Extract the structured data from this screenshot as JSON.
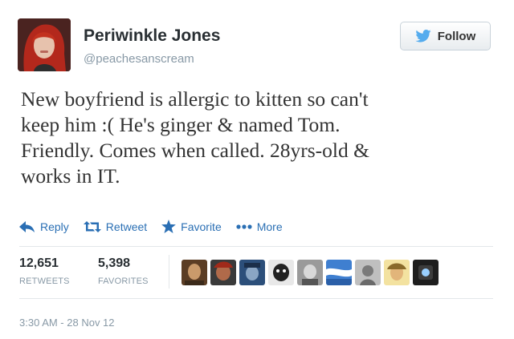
{
  "profile": {
    "name": "Periwinkle Jones",
    "handle": "@peachesanscream"
  },
  "follow_label": "Follow",
  "tweet": {
    "lines": [
      "New boyfriend is allergic to kitten so can't",
      "keep him :( He's ginger & named Tom.",
      "Friendly. Comes when called. 28yrs-old &",
      "works in IT."
    ]
  },
  "actions": {
    "reply": "Reply",
    "retweet": "Retweet",
    "favorite": "Favorite",
    "more": "More"
  },
  "stats": {
    "retweets_count": "12,651",
    "retweets_label": "RETWEETS",
    "favorites_count": "5,398",
    "favorites_label": "FAVORITES"
  },
  "favoriter_avatar_count": 9,
  "timestamp": "3:30 AM - 28 Nov 12",
  "colors": {
    "link_blue": "#2a6fb4",
    "twitter_bird": "#55acee",
    "muted_gray": "#8899a6"
  }
}
